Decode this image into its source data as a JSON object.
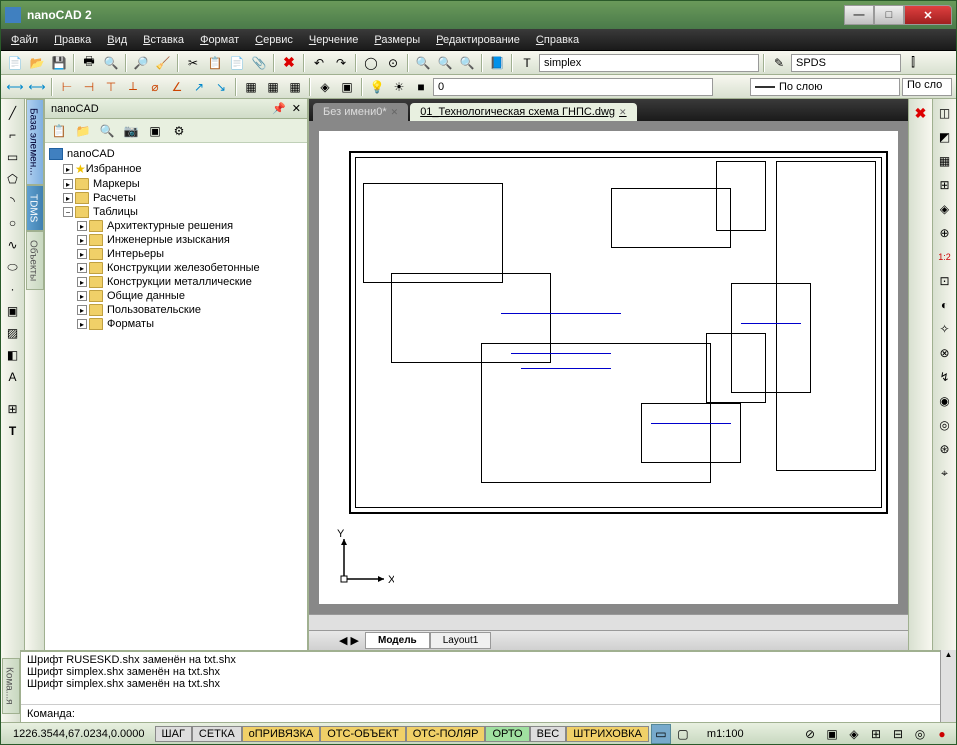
{
  "app": {
    "title": "nanoCAD 2"
  },
  "menu": [
    "Файл",
    "Правка",
    "Вид",
    "Вставка",
    "Формат",
    "Сервис",
    "Черчение",
    "Размеры",
    "Редактирование",
    "Справка"
  ],
  "toolbar1": {
    "font_input": "simplex",
    "spds_input": "SPDS"
  },
  "toolbar2": {
    "layer_input": "0",
    "bylayer": "По слою",
    "bylayer2": "По сло"
  },
  "panel": {
    "title": "nanoCAD",
    "root": "nanoCAD",
    "items": [
      {
        "label": "Избранное",
        "icon": "star",
        "depth": 1
      },
      {
        "label": "Маркеры",
        "icon": "folder",
        "depth": 1
      },
      {
        "label": "Расчеты",
        "icon": "folder",
        "depth": 1
      },
      {
        "label": "Таблицы",
        "icon": "folder",
        "depth": 1,
        "expanded": true
      },
      {
        "label": "Архитектурные решения",
        "icon": "folder",
        "depth": 2
      },
      {
        "label": "Инженерные изыскания",
        "icon": "folder",
        "depth": 2
      },
      {
        "label": "Интерьеры",
        "icon": "folder",
        "depth": 2
      },
      {
        "label": "Конструкции железобетонные",
        "icon": "folder",
        "depth": 2
      },
      {
        "label": "Конструкции металлические",
        "icon": "folder",
        "depth": 2
      },
      {
        "label": "Общие данные",
        "icon": "folder",
        "depth": 2
      },
      {
        "label": "Пользовательские",
        "icon": "folder",
        "depth": 2
      },
      {
        "label": "Форматы",
        "icon": "folder",
        "depth": 2
      }
    ]
  },
  "vtabs": [
    "База элемен...",
    "TDMS",
    "Объекты"
  ],
  "vtab_left": "Кома...я",
  "doc_tabs": [
    {
      "label": "Без имени0*",
      "active": false
    },
    {
      "label": "01_Технологическая схема ГНПС.dwg",
      "active": true
    }
  ],
  "layout_tabs": [
    {
      "label": "Модель",
      "active": true
    },
    {
      "label": "Layout1",
      "active": false
    }
  ],
  "command_log": [
    "Шрифт RUSESKD.shx заменён на txt.shx",
    "Шрифт simplex.shx заменён на txt.shx",
    "Шрифт simplex.shx заменён на txt.shx"
  ],
  "command_prompt": "Команда:",
  "status": {
    "coords": "1226.3544,67.0234,0.0000",
    "toggles": [
      {
        "label": "ШАГ",
        "on": false
      },
      {
        "label": "СЕТКА",
        "on": false
      },
      {
        "label": "оПРИВЯЗКА",
        "on": true
      },
      {
        "label": "ОТС-ОБЪЕКТ",
        "on": true
      },
      {
        "label": "ОТС-ПОЛЯР",
        "on": true
      },
      {
        "label": "ОРТО",
        "on": true,
        "green": true
      },
      {
        "label": "ВЕС",
        "on": false
      },
      {
        "label": "ШТРИХОВКА",
        "on": true
      }
    ],
    "scale": "m1:100"
  }
}
